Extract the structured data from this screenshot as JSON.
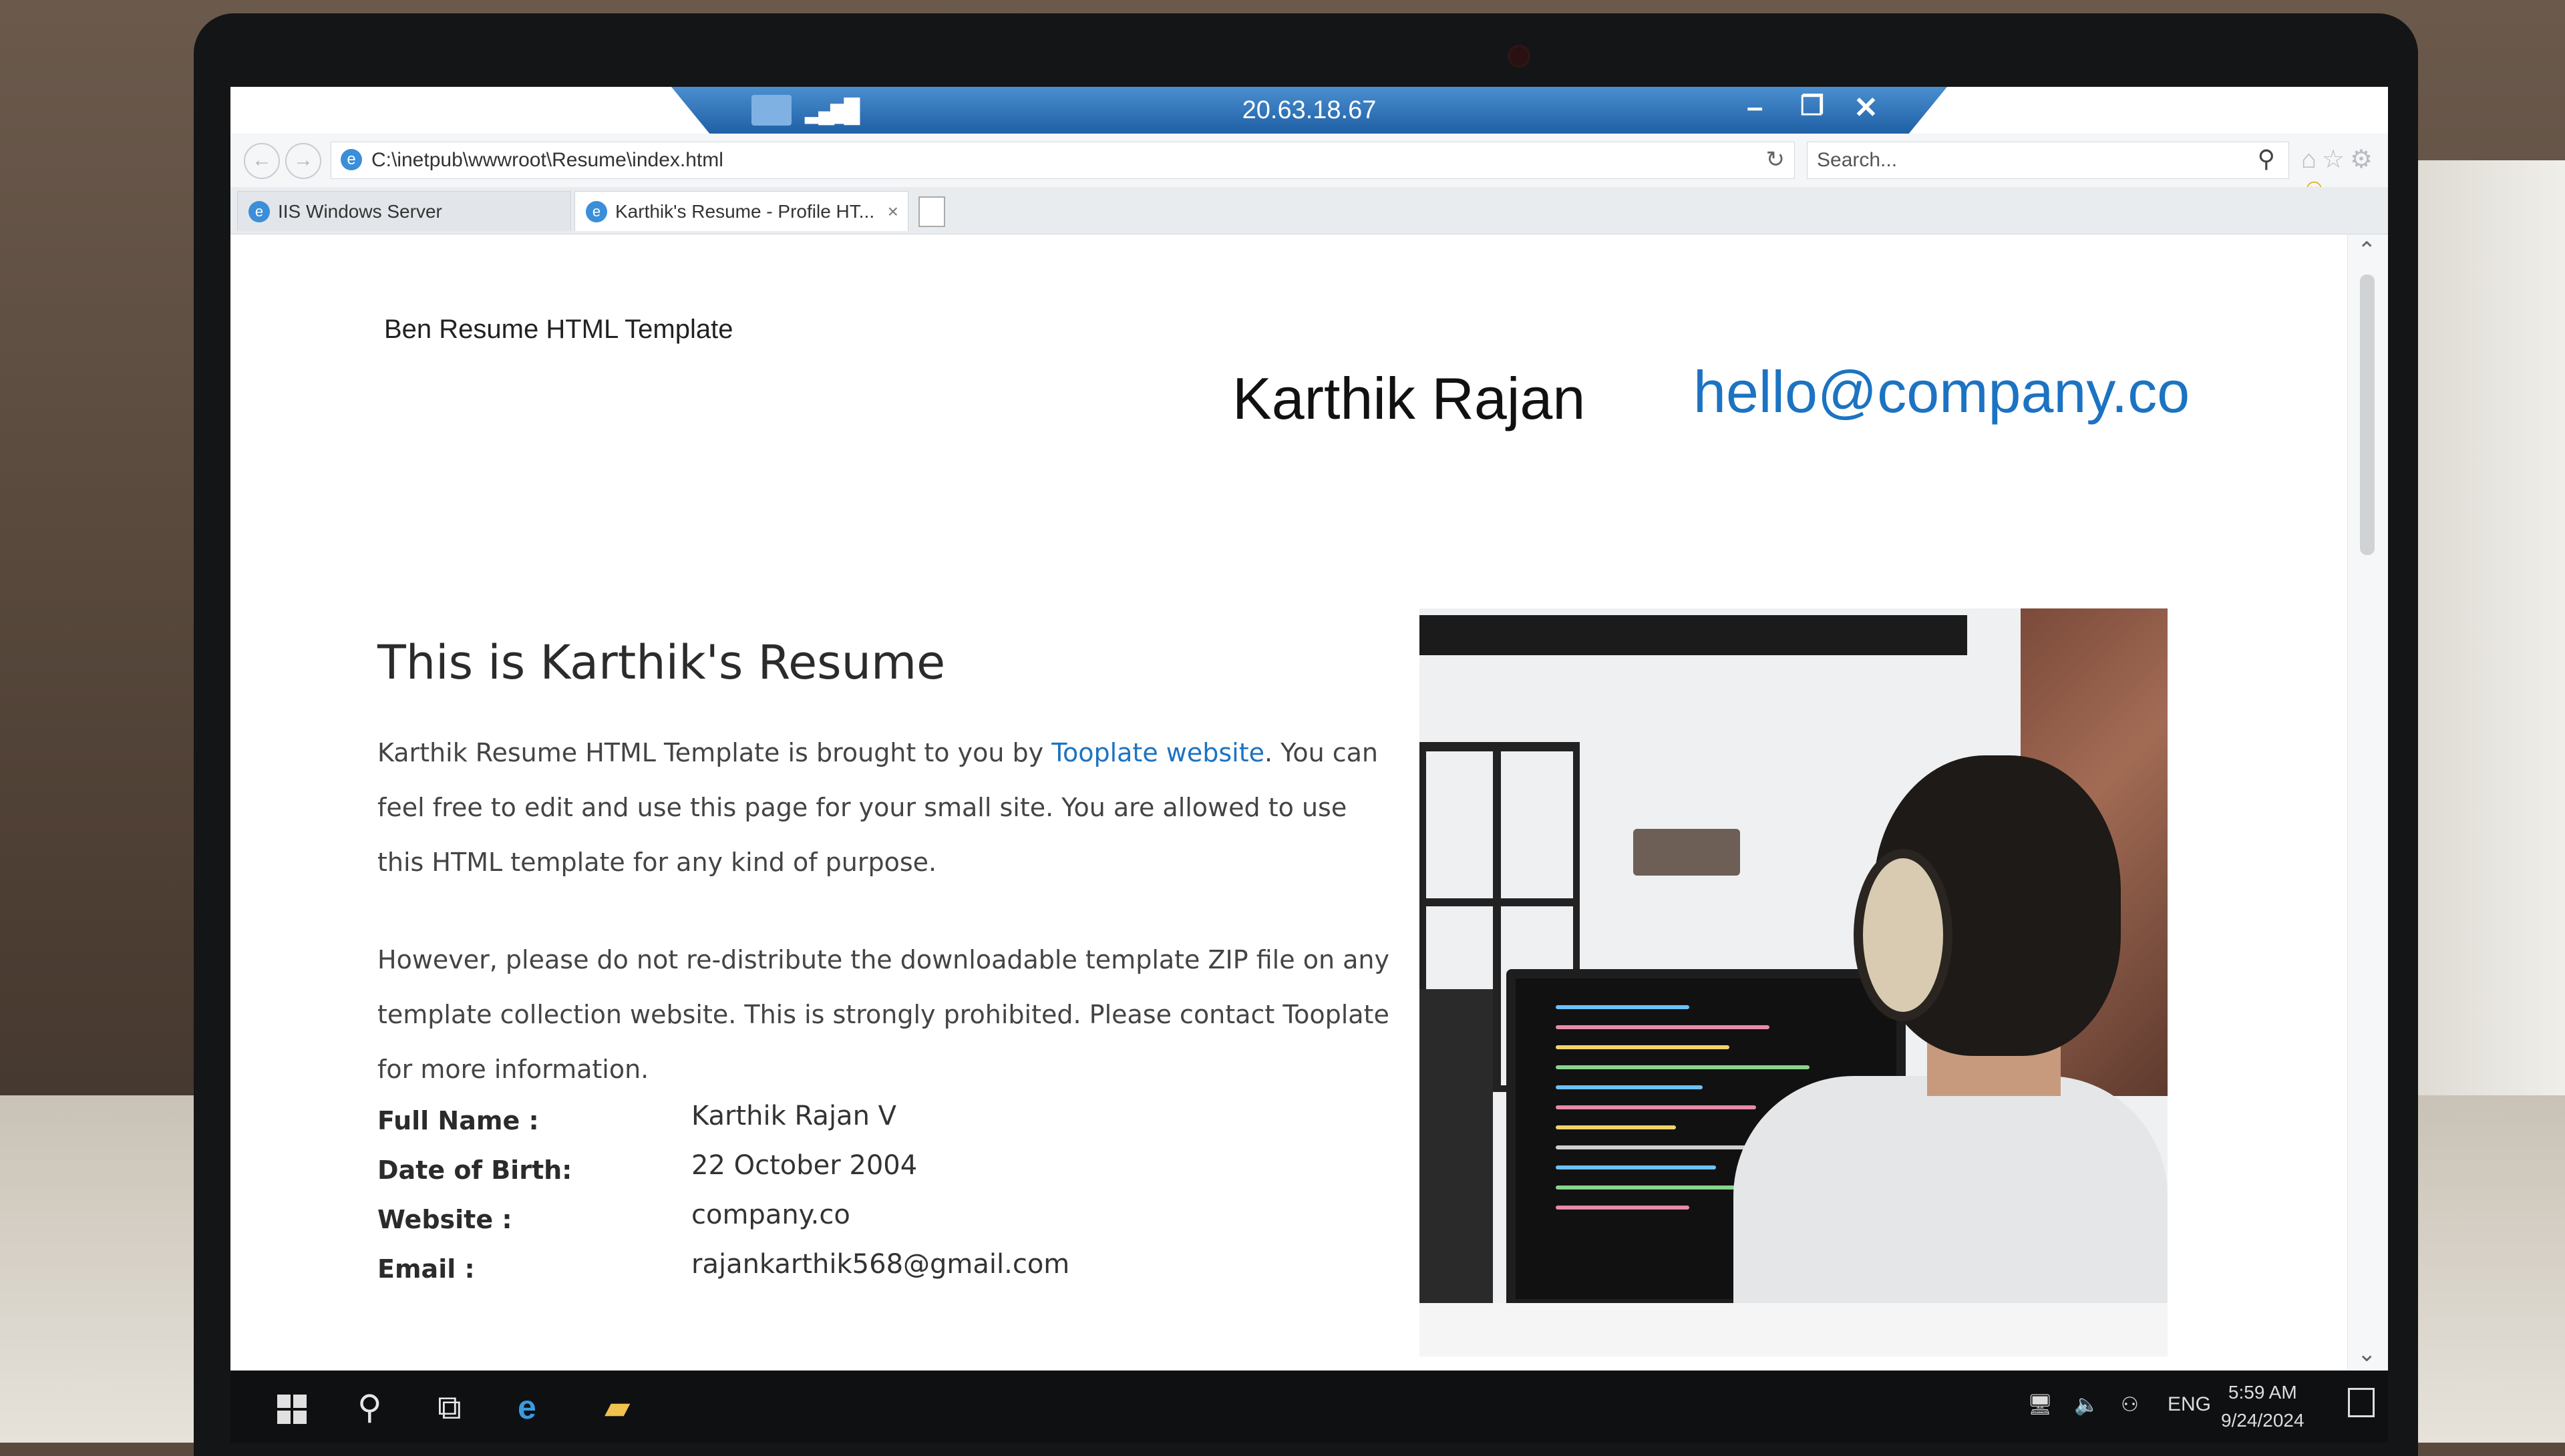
{
  "rdp": {
    "host": "20.63.18.67"
  },
  "browser": {
    "address": "C:\\inetpub\\wwwroot\\Resume\\index.html",
    "search_placeholder": "Search...",
    "tabs": [
      {
        "label": "IIS Windows Server"
      },
      {
        "label": "Karthik's Resume - Profile HT..."
      }
    ]
  },
  "site": {
    "brand": "Ben Resume HTML Template",
    "hero_name": "Karthik Rajan",
    "hero_email": "hello@company.co"
  },
  "about": {
    "title": "This is Karthik's Resume",
    "p1_before": "Karthik Resume HTML Template is brought to you by ",
    "p1_link": "Tooplate website",
    "p1_after": ". You can feel free to edit and use this page for your small site. You are allowed to use this HTML template for any kind of purpose.",
    "p2": "However, please do not re-distribute the downloadable template ZIP file on any template collection website. This is strongly prohibited. Please contact Tooplate for more information."
  },
  "info": [
    {
      "label": "Full Name :",
      "value": "Karthik Rajan V"
    },
    {
      "label": "Date of Birth:",
      "value": "22 October 2004"
    },
    {
      "label": "Website :",
      "value": "company.co"
    },
    {
      "label": "Email :",
      "value": "rajankarthik568@gmail.com"
    }
  ],
  "taskbar": {
    "lang": "ENG",
    "time": "5:59 AM",
    "date": "9/24/2024"
  },
  "colors": {
    "link": "#1c73c2",
    "rdp_bar": "#1f5fa4",
    "taskbar": "#0f1012"
  }
}
